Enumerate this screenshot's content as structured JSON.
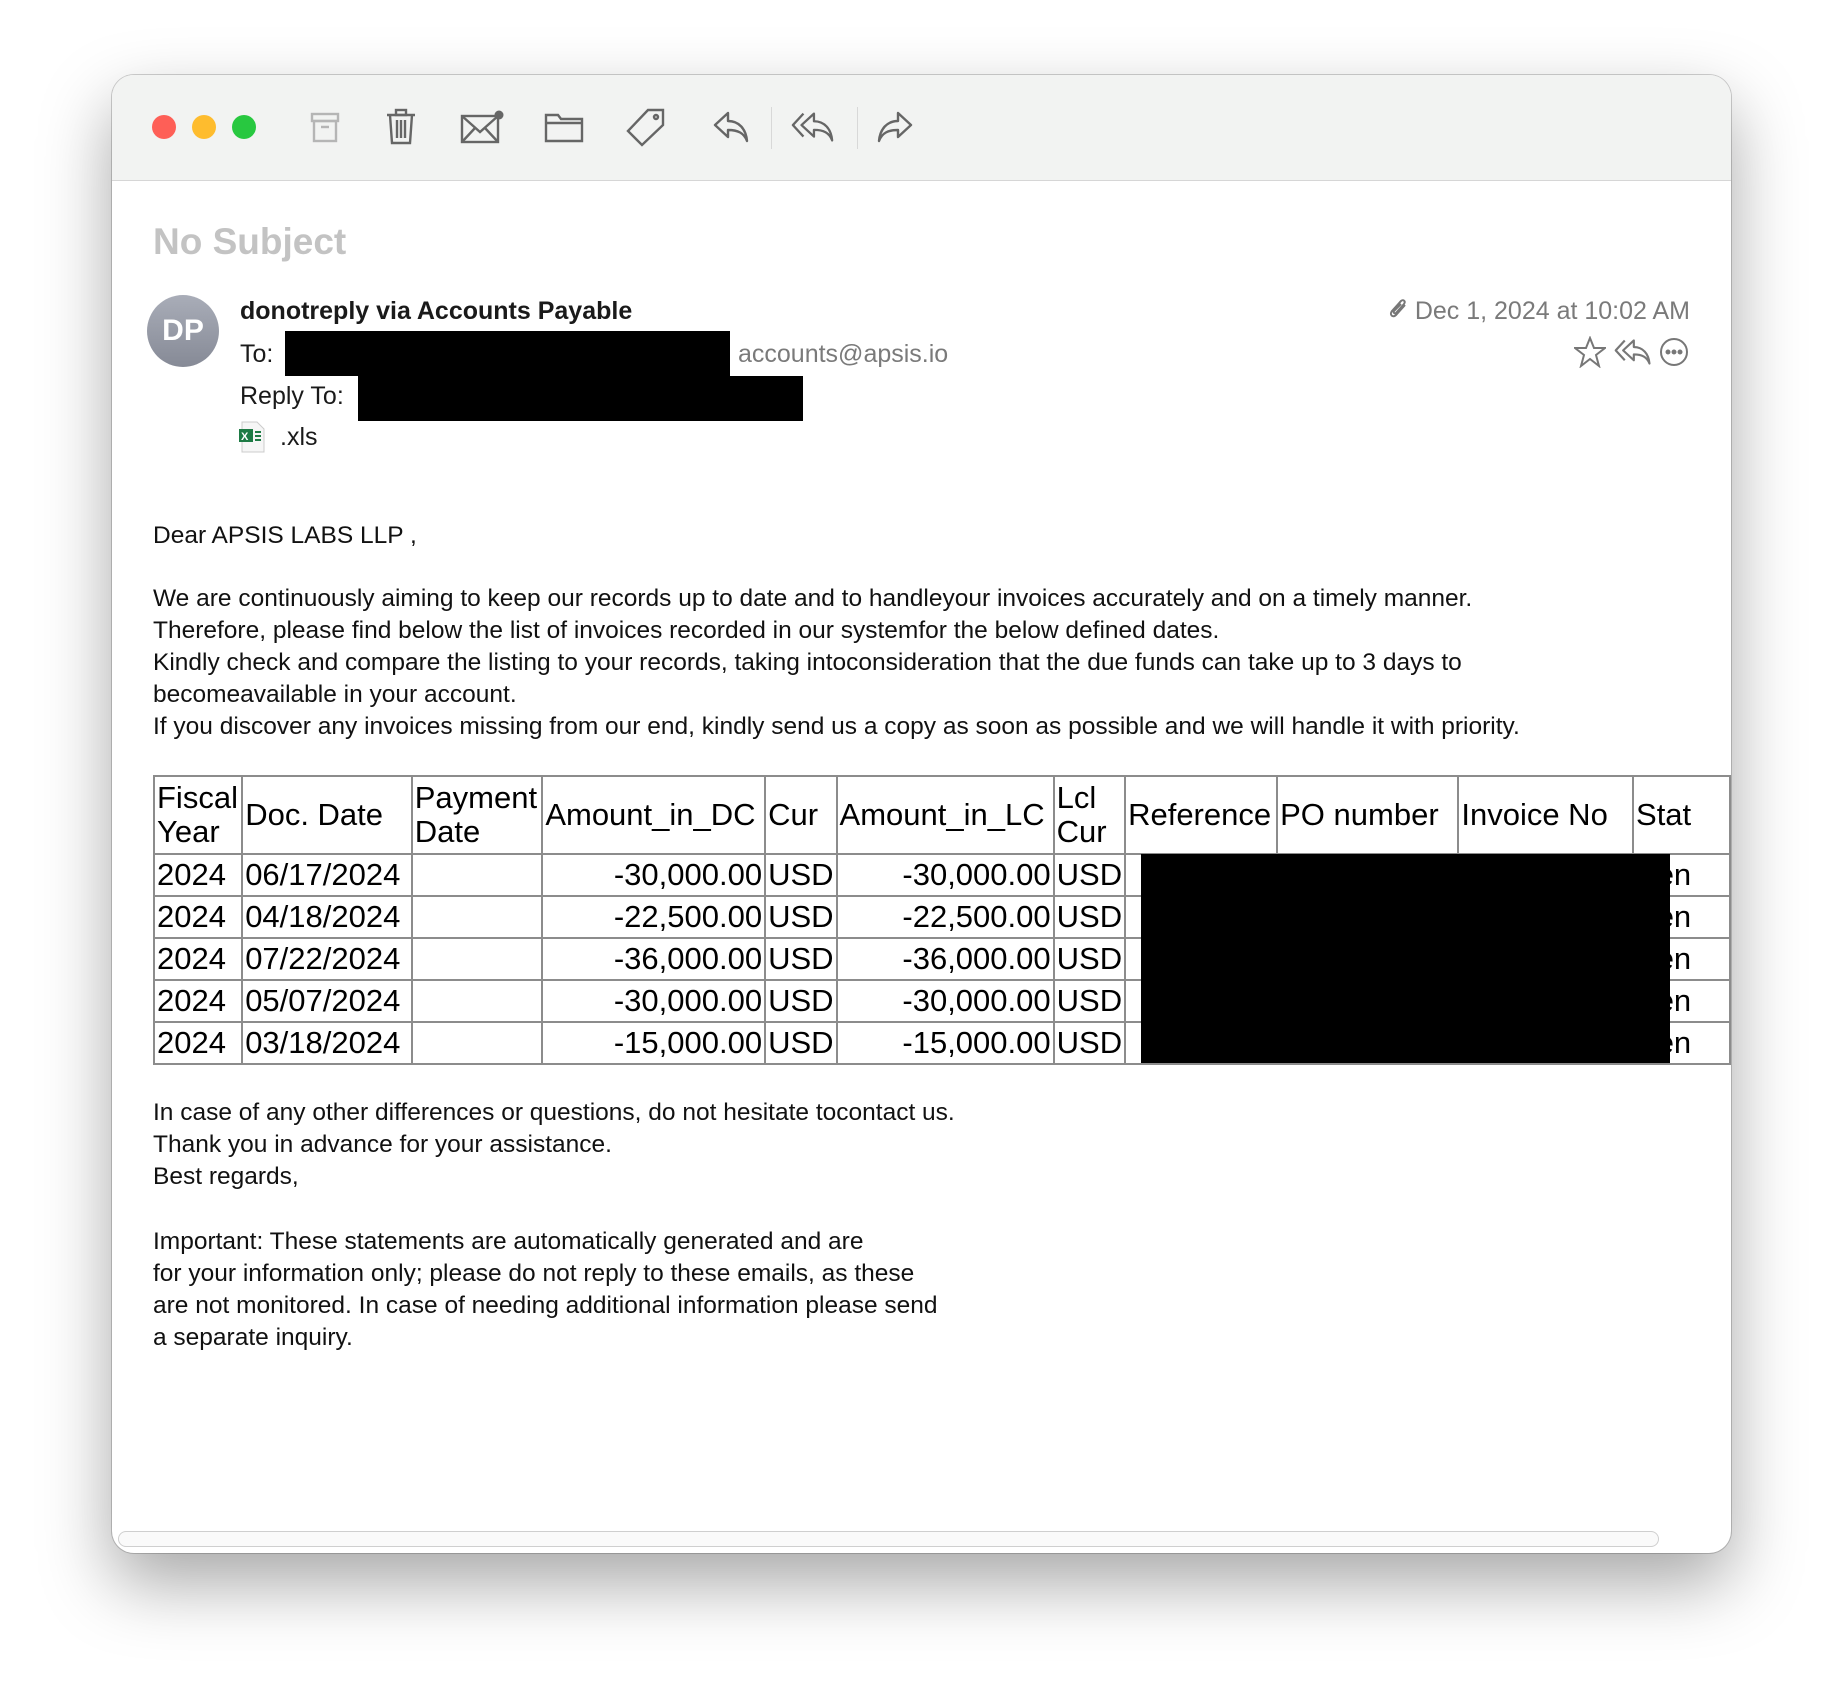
{
  "toolbar": {
    "icons": [
      "archive-icon",
      "trash-icon",
      "mail-unread-icon",
      "folder-icon",
      "tag-icon",
      "reply-icon",
      "reply-all-icon",
      "forward-icon"
    ]
  },
  "message": {
    "subject": "No Subject",
    "avatar_initials": "DP",
    "sender": "donotreply via Accounts Payable",
    "to_label": "To:",
    "to_visible": "accounts@apsis.io",
    "reply_to_label": "Reply To:",
    "attachment": ".xls",
    "date": "Dec 1, 2024 at 10:02 AM"
  },
  "body": {
    "greeting": "Dear APSIS LABS LLP ,",
    "paragraph": [
      "We are continuously aiming to keep our records up to date and to handleyour invoices accurately and on a timely manner.",
      "Therefore, please find below the list of invoices recorded in our systemfor the below defined dates.",
      "Kindly check and compare the listing to your records, taking intoconsideration that the due funds can take up to 3 days to",
      "becomeavailable in your account.",
      "If you discover any invoices missing from our end, kindly send us a copy as soon as possible and we will handle it with priority."
    ],
    "closing": [
      "In case of any other differences or questions, do not hesitate tocontact us.",
      "Thank you in advance for your assistance.",
      "Best regards,"
    ],
    "important": [
      "Important: These statements are automatically generated and are",
      "for your information only; please do not reply to these emails, as these",
      "are not monitored. In case of needing additional information please send",
      "a separate inquiry."
    ]
  },
  "table": {
    "headers": [
      "Fiscal Year",
      "Doc. Date",
      "Payment Date",
      "Amount_in_DC",
      "Cur",
      "Amount_in_LC",
      "Lcl Cur",
      "Reference",
      "PO number",
      "Invoice No",
      "Stat"
    ],
    "rows": [
      [
        "2024",
        "06/17/2024",
        "",
        "-30,000.00",
        "USD",
        "-30,000.00",
        "USD",
        "Pen"
      ],
      [
        "2024",
        "04/18/2024",
        "",
        "-22,500.00",
        "USD",
        "-22,500.00",
        "USD",
        "Pen"
      ],
      [
        "2024",
        "07/22/2024",
        "",
        "-36,000.00",
        "USD",
        "-36,000.00",
        "USD",
        "Pen"
      ],
      [
        "2024",
        "05/07/2024",
        "",
        "-30,000.00",
        "USD",
        "-30,000.00",
        "USD",
        "Pen"
      ],
      [
        "2024",
        "03/18/2024",
        "",
        "-15,000.00",
        "USD",
        "-15,000.00",
        "USD",
        "Pen"
      ]
    ]
  }
}
